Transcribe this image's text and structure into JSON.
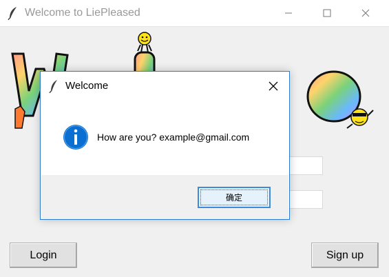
{
  "main_window": {
    "title": "Welcome to LiePleased",
    "controls": [
      "minimize",
      "maximize",
      "close"
    ],
    "banner_word": "Welcome",
    "buttons": {
      "login": "Login",
      "signup": "Sign up"
    }
  },
  "dialog": {
    "title": "Welcome",
    "message": "How are you? example@gmail.com",
    "ok_label": "确定",
    "icon": "info-icon"
  },
  "colors": {
    "dialog_border": "#2b79d0",
    "info_icon": "#0a6fd0",
    "ok_border": "#3c8ad8",
    "ok_fill": "#e5f1fb"
  }
}
